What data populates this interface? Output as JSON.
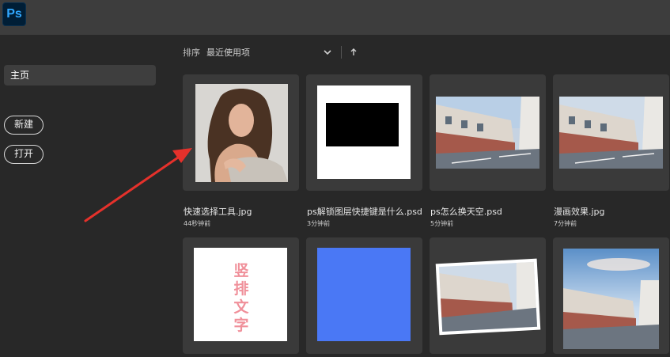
{
  "app": {
    "logo_text": "Ps"
  },
  "sidebar": {
    "home_label": "主页",
    "new_button": "新建",
    "open_button": "打开"
  },
  "sort": {
    "label": "排序",
    "value": "最近使用项",
    "direction_icon": "up-arrow-icon"
  },
  "files": [
    {
      "name": "快速选择工具.jpg",
      "time": "44秒钟前",
      "thumb": "portrait-woman"
    },
    {
      "name": "ps解锁图层快捷键是什么.psd",
      "time": "3分钟前",
      "thumb": "black-rectangle"
    },
    {
      "name": "ps怎么换天空.psd",
      "time": "5分钟前",
      "thumb": "street-scene"
    },
    {
      "name": "漫画效果.jpg",
      "time": "7分钟前",
      "thumb": "street-scene"
    },
    {
      "name": "",
      "time": "",
      "thumb": "vertical-text",
      "text": "竖排文字"
    },
    {
      "name": "",
      "time": "",
      "thumb": "blue-square"
    },
    {
      "name": "",
      "time": "",
      "thumb": "street-scene-tilted"
    },
    {
      "name": "",
      "time": "",
      "thumb": "street-scene-sky"
    }
  ],
  "colors": {
    "accent_blue": "#4a78f5",
    "arrow_red": "#e5312b",
    "vertical_text_pink": "#f0909a"
  }
}
